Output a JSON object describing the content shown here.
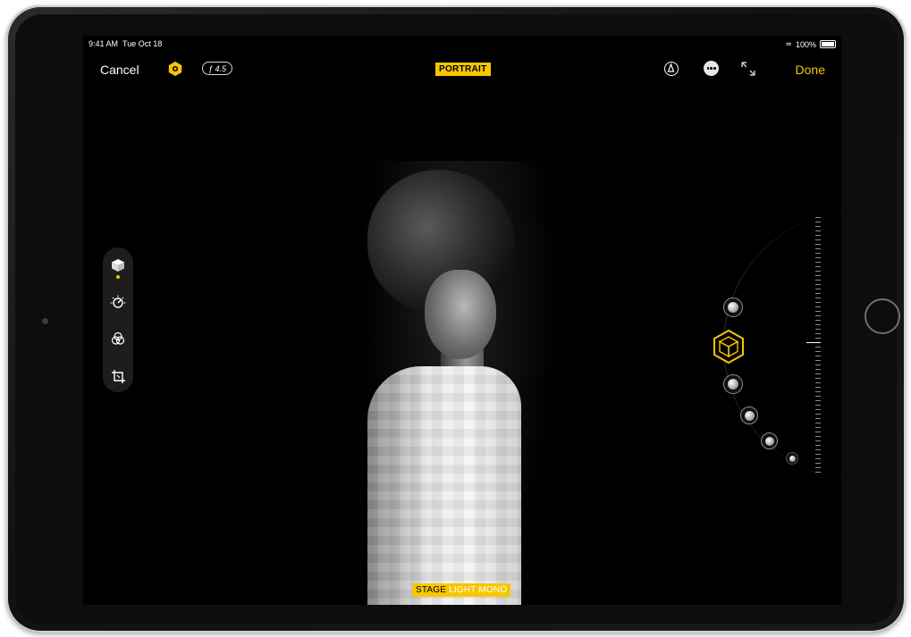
{
  "status_bar": {
    "time": "9:41 AM",
    "date": "Tue Oct 18",
    "battery": "100%"
  },
  "toolbar": {
    "cancel_label": "Cancel",
    "aperture_value": "ƒ 4.5",
    "mode_badge": "PORTRAIT",
    "done_label": "Done"
  },
  "tools": [
    {
      "icon": "portrait-lighting-cube-icon",
      "active": true
    },
    {
      "icon": "adjust-dial-icon",
      "active": false
    },
    {
      "icon": "filters-icon",
      "active": false
    },
    {
      "icon": "crop-icon",
      "active": false
    }
  ],
  "lighting_effect": {
    "prefix": "STAGE",
    "suffix": "LIGHT MONO"
  },
  "lighting_options": [
    "natural-light",
    "stage-light-mono",
    "contour-light",
    "stage-light",
    "studio-light",
    "high-key-light-mono"
  ],
  "colors": {
    "accent": "#f7c600",
    "screen_bg": "#000000",
    "text": "#ffffff"
  }
}
